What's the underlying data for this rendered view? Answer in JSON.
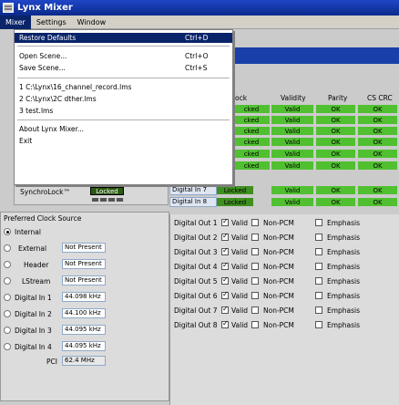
{
  "window": {
    "title": "Lynx Mixer"
  },
  "menubar": {
    "items": [
      "Mixer",
      "Settings",
      "Window"
    ]
  },
  "mixer_menu": {
    "items": [
      {
        "label": "Restore Defaults",
        "accel": "Ctrl+D",
        "highlight": true
      },
      {
        "label": "Open Scene...",
        "accel": "Ctrl+O"
      },
      {
        "label": "Save Scene...",
        "accel": "Ctrl+S"
      },
      {
        "label": "1 C:\\Lynx\\16_channel_record.lms",
        "accel": ""
      },
      {
        "label": "2 C:\\Lynx\\2C dther.lms",
        "accel": ""
      },
      {
        "label": "3 test.lms",
        "accel": ""
      },
      {
        "label": "About Lynx Mixer...",
        "accel": ""
      },
      {
        "label": "Exit",
        "accel": ""
      }
    ]
  },
  "status_grid": {
    "headers": {
      "col0": "ock",
      "validity": "Validity",
      "parity": "Parity",
      "cscrc": "CS CRC"
    },
    "rows": [
      {
        "lock": "cked",
        "validity": "Valid",
        "parity": "OK",
        "cscrc": "OK"
      },
      {
        "lock": "cked",
        "validity": "Valid",
        "parity": "OK",
        "cscrc": "OK"
      },
      {
        "lock": "cked",
        "validity": "Valid",
        "parity": "OK",
        "cscrc": "OK"
      },
      {
        "lock": "cked",
        "validity": "Valid",
        "parity": "OK",
        "cscrc": "OK"
      },
      {
        "lock": "cked",
        "validity": "Valid",
        "parity": "OK",
        "cscrc": "OK"
      },
      {
        "lock": "cked",
        "validity": "Valid",
        "parity": "OK",
        "cscrc": "OK"
      }
    ],
    "digital_in_rows": [
      {
        "label": "Digital In 7",
        "lock": "Locked",
        "validity": "Valid",
        "parity": "OK",
        "cscrc": "OK"
      },
      {
        "label": "Digital In 8",
        "lock": "Locked",
        "validity": "Valid",
        "parity": "OK",
        "cscrc": "OK"
      }
    ]
  },
  "sync": {
    "label": "SynchroLock™",
    "status": "Locked"
  },
  "preferred_clock": {
    "title": "Preferred Clock Source",
    "options": [
      {
        "label": "Internal",
        "value": "",
        "selected": true
      },
      {
        "label": "External",
        "value": "Not Present",
        "selected": false
      },
      {
        "label": "Header",
        "value": "Not Present",
        "selected": false
      },
      {
        "label": "LStream",
        "value": "Not Present",
        "selected": false
      },
      {
        "label": "Digital In 1",
        "value": "44.098 kHz",
        "selected": false
      },
      {
        "label": "Digital In 2",
        "value": "44.100 kHz",
        "selected": false
      },
      {
        "label": "Digital In 3",
        "value": "44.095 kHz",
        "selected": false
      },
      {
        "label": "Digital In 4",
        "value": "44.095 kHz",
        "selected": false
      }
    ],
    "pci": {
      "label": "PCI",
      "value": "62.4 MHz"
    }
  },
  "digital_outs": [
    {
      "label": "Digital Out 1",
      "valid": "Valid",
      "nonpcm": "Non-PCM",
      "emph": "Emphasis"
    },
    {
      "label": "Digital Out 2",
      "valid": "Valid",
      "nonpcm": "Non-PCM",
      "emph": "Emphasis"
    },
    {
      "label": "Digital Out 3",
      "valid": "Valid",
      "nonpcm": "Non-PCM",
      "emph": "Emphasis"
    },
    {
      "label": "Digital Out 4",
      "valid": "Valid",
      "nonpcm": "Non-PCM",
      "emph": "Emphasis"
    },
    {
      "label": "Digital Out 5",
      "valid": "Valid",
      "nonpcm": "Non-PCM",
      "emph": "Emphasis"
    },
    {
      "label": "Digital Out 6",
      "valid": "Valid",
      "nonpcm": "Non-PCM",
      "emph": "Emphasis"
    },
    {
      "label": "Digital Out 7",
      "valid": "Valid",
      "nonpcm": "Non-PCM",
      "emph": "Emphasis"
    },
    {
      "label": "Digital Out 8",
      "valid": "Valid",
      "nonpcm": "Non-PCM",
      "emph": "Emphasis"
    }
  ],
  "colors": {
    "accent": "#0a246a",
    "status_green": "#50c030",
    "titlebar": "#1f46c8"
  }
}
